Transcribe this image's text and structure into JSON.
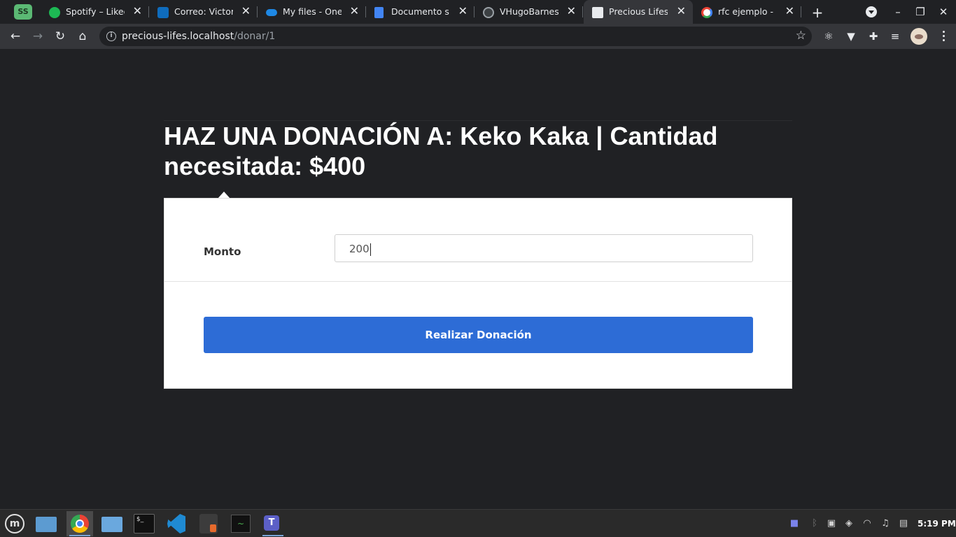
{
  "browser": {
    "profile_chip": "SS",
    "tabs": [
      {
        "title": "Spotify – Liked Songs",
        "favicon_color": "#1db954"
      },
      {
        "title": "Correo: Victor H",
        "favicon_color": "#0f6cbd"
      },
      {
        "title": "My files - OneDrive",
        "favicon_color": "#1e88e5"
      },
      {
        "title": "Documento sin título",
        "favicon_color": "#4285f4"
      },
      {
        "title": "VHugoBarnes (",
        "favicon_color": "#e8eaed"
      },
      {
        "title": "Precious Lifes",
        "favicon_color": "#e8eaed"
      },
      {
        "title": "rfc ejemplo - Buscar",
        "favicon_color": "#ea4335"
      }
    ],
    "active_tab_index": 5,
    "new_tab_glyph": "+",
    "window_controls": {
      "minimize": "–",
      "restore": "❐",
      "close": "✕"
    },
    "url_host": "precious-lifes.localhost",
    "url_path": "/donar/1",
    "extension_icons": [
      "react-icon",
      "vue-icon",
      "puzzle-icon",
      "media-icon"
    ]
  },
  "page": {
    "title": "HAZ UNA DONACIÓN A: Keko Kaka | Cantidad necesitada: $400",
    "form": {
      "monto_label": "Monto",
      "monto_value": "200",
      "submit_label": "Realizar Donación"
    },
    "colors": {
      "background": "#202124",
      "card": "#ffffff",
      "button": "#2d6cd6"
    }
  },
  "taskbar": {
    "apps": [
      "mint-menu-icon",
      "folder-icon",
      "chrome-icon",
      "files-icon",
      "terminal-icon",
      "vscode-icon",
      "calculator-icon",
      "system-monitor-icon",
      "teams-icon"
    ],
    "terminal_glyph": "$_",
    "clock": "5:19 PM"
  }
}
